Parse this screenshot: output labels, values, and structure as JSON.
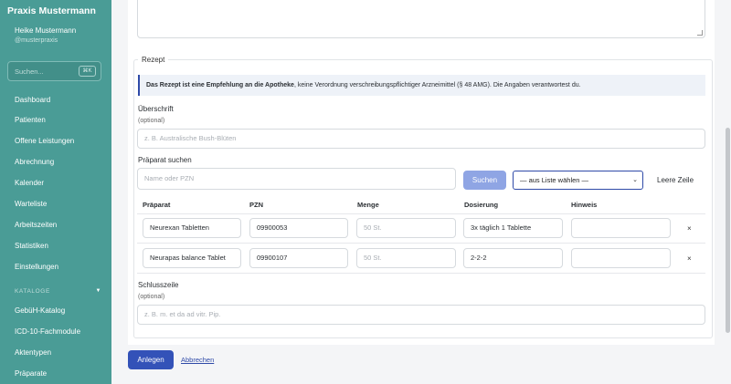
{
  "sidebar": {
    "brand": "Praxis Mustermann",
    "user_name": "Heike Mustermann",
    "user_handle": "@musterpraxis",
    "search_placeholder": "Suchen...",
    "search_shortcut": "⌘K",
    "items": [
      {
        "label": "Dashboard"
      },
      {
        "label": "Patienten"
      },
      {
        "label": "Offene Leistungen"
      },
      {
        "label": "Abrechnung"
      },
      {
        "label": "Kalender"
      },
      {
        "label": "Warteliste"
      },
      {
        "label": "Arbeitszeiten"
      },
      {
        "label": "Statistiken"
      },
      {
        "label": "Einstellungen"
      }
    ],
    "catalog_header": "KATALOGE",
    "catalog_items": [
      {
        "label": "GebüH-Katalog"
      },
      {
        "label": "ICD-10-Fachmodule"
      },
      {
        "label": "Aktentypen"
      },
      {
        "label": "Präparate"
      }
    ]
  },
  "form": {
    "section_title": "Rezept",
    "info_bold": "Das Rezept ist eine Empfehlung an die Apotheke",
    "info_rest": ", keine Verordnung verschreibungspflichtiger Arzneimittel (§ 48 AMG). Die Angaben verantwortest du.",
    "heading_label": "Überschrift",
    "heading_optional": "(optional)",
    "heading_placeholder": "z. B. Australische Bush-Blüten",
    "search_label": "Präparat suchen",
    "search_placeholder": "Name oder PZN",
    "search_button": "Suchen",
    "select_value": "— aus Liste wählen —",
    "empty_row_button": "Leere Zeile",
    "columns": [
      "Präparat",
      "PZN",
      "Menge",
      "Dosierung",
      "Hinweis"
    ],
    "rows": [
      {
        "name": "Neurexan Tabletten",
        "pzn": "09900053",
        "menge_placeholder": "50 St.",
        "dosierung": "3x täglich 1 Tablette",
        "hinweis": "",
        "remove": "×"
      },
      {
        "name": "Neurapas balance Tablet",
        "pzn": "09900107",
        "menge_placeholder": "50 St.",
        "dosierung": "2-2-2",
        "hinweis": "",
        "remove": "×"
      }
    ],
    "closing_label": "Schlusszeile",
    "closing_optional": "(optional)",
    "closing_placeholder": "z. B. m. et da ad vitr. Pip."
  },
  "actions": {
    "submit": "Anlegen",
    "cancel": "Abbrechen"
  }
}
